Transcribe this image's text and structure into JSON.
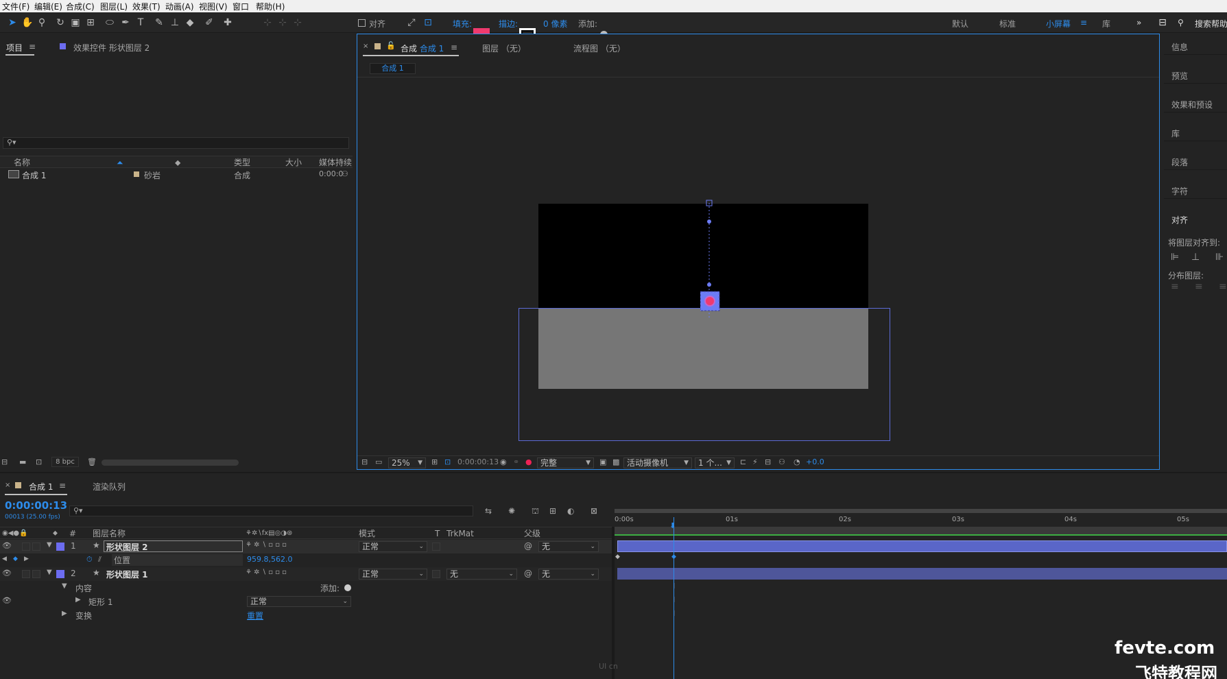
{
  "menubar": {
    "items": [
      "文件(F)",
      "编辑(E)",
      "合成(C)",
      "图层(L)",
      "效果(T)",
      "动画(A)",
      "视图(V)",
      "窗口",
      "帮助(H)"
    ]
  },
  "toolbar": {
    "tools": [
      "selection-tool",
      "hand-tool",
      "zoom-tool",
      "rotate-tool",
      "camera-tool",
      "pan-behind-tool",
      "ellipse-tool",
      "pen-tool",
      "text-tool",
      "brush-tool",
      "clone-stamp-tool",
      "eraser-tool",
      "roto-brush-tool",
      "puppet-pin-tool"
    ],
    "align_label": "对齐",
    "fill_label": "填充:",
    "stroke_label": "描边:",
    "stroke_width": "0 像素",
    "add_label": "添加:",
    "fill_color": "#ef3a6e",
    "workspaces": [
      "默认",
      "标准",
      "小屏幕",
      "库"
    ],
    "active_workspace": "小屏幕",
    "search_placeholder": "搜索帮助"
  },
  "project_panel": {
    "tab_project": "项目",
    "tab_effects": "效果控件 形状图层 2",
    "search_placeholder": "",
    "columns": [
      "名称",
      "类型",
      "大小",
      "媒体持续"
    ],
    "items": [
      {
        "name": "合成 1",
        "label": "砂岩",
        "type": "合成",
        "duration": "0:00:0"
      }
    ],
    "bpc": "8 bpc"
  },
  "comp_panel": {
    "tab_comp_prefix": "合成",
    "tab_comp_name": "合成 1",
    "tab_layer": "图层 （无）",
    "tab_flow": "流程图 （无）",
    "sub_tab": "合成 1",
    "zoom": "25%",
    "timecode": "0:00:00:13",
    "resolution": "完整",
    "camera": "活动摄像机",
    "views": "1 个...",
    "exposure": "+0.0"
  },
  "right_panel": {
    "items": [
      "信息",
      "预览",
      "效果和预设",
      "库",
      "段落",
      "字符",
      "对齐"
    ],
    "align_to": "将图层对齐到:",
    "distribute": "分布图层:"
  },
  "timeline": {
    "tab_comp": "合成 1",
    "tab_render": "渲染队列",
    "timecode": "0:00:00:13",
    "frame_info": "00013 (25.00 fps)",
    "columns": {
      "layer_name": "图层名称",
      "mode": "模式",
      "t": "T",
      "trkmat": "TrkMat",
      "parent": "父级"
    },
    "ruler": [
      "0:00s",
      "01s",
      "02s",
      "03s",
      "04s",
      "05s"
    ],
    "layers": [
      {
        "num": "1",
        "name": "形状图层 2",
        "mode": "正常",
        "parent": "无"
      },
      {
        "num": "2",
        "name": "形状图层 1",
        "mode": "正常",
        "trkmat": "无",
        "parent": "无"
      }
    ],
    "position_label": "位置",
    "position_value": "959.8,562.0",
    "contents_label": "内容",
    "add_label": "添加:",
    "rect_label": "矩形 1",
    "rect_mode": "正常",
    "transform_label": "变换",
    "reset_label": "重置",
    "current_time_fraction": 0.52
  },
  "watermark": {
    "site": "fevte.com",
    "name": "飞特教程网",
    "ui_logo": "UI cn"
  }
}
